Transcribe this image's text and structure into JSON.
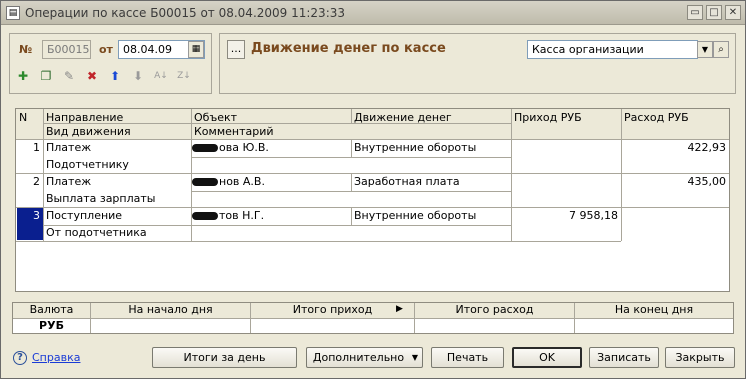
{
  "window": {
    "title": "Операции по кассе Б00015 от 08.04.2009 11:23:33",
    "title_buttons": [
      "▭",
      "□",
      "✕"
    ]
  },
  "doc": {
    "number_label": "№",
    "number_value": "Б00015",
    "date_label": "от",
    "date_value": "08.04.09"
  },
  "toolbar_icons": [
    "add-row-icon",
    "copy-row-icon",
    "edit-row-icon",
    "delete-row-icon",
    "move-up-icon",
    "move-down-icon",
    "sort-asc-icon",
    "sort-desc-icon"
  ],
  "operation": {
    "select_button": "...",
    "title": "Движение денег по кассе",
    "cashbox_value": "Касса организации"
  },
  "table": {
    "headers": {
      "n": "N",
      "direction": "Направление",
      "movement_type": "Вид движения",
      "object": "Объект",
      "comment": "Комментарий",
      "money_movement": "Движение денег",
      "income": "Приход РУБ",
      "expense": "Расход РУБ"
    },
    "rows": [
      {
        "n": "1",
        "direction": "Платеж",
        "movement_type": "Подотчетнику",
        "object": "ова Ю.В.",
        "money_movement": "Внутренние обороты",
        "income": "",
        "expense": "422,93"
      },
      {
        "n": "2",
        "direction": "Платеж",
        "movement_type": "Выплата зарплаты",
        "object": "нов А.В.",
        "money_movement": "Заработная плата",
        "income": "",
        "expense": "435,00"
      },
      {
        "n": "3",
        "direction": "Поступление",
        "movement_type": "От подотчетника",
        "object": "тов Н.Г.",
        "money_movement": "Внутренние обороты",
        "income": "7 958,18",
        "expense": ""
      }
    ]
  },
  "totals": {
    "headers": [
      "Валюта",
      "На начало дня",
      "Итого приход",
      "Итого расход",
      "На конец дня"
    ],
    "currency": "РУБ"
  },
  "footer": {
    "help": "Справка",
    "day_totals": "Итоги за день",
    "more": "Дополнительно",
    "print": "Печать",
    "ok": "OK",
    "save": "Записать",
    "close": "Закрыть"
  },
  "colors": {
    "selected_cell": "#0a1f8f",
    "heading": "#7a4a1e",
    "link": "#1a3bd6"
  }
}
